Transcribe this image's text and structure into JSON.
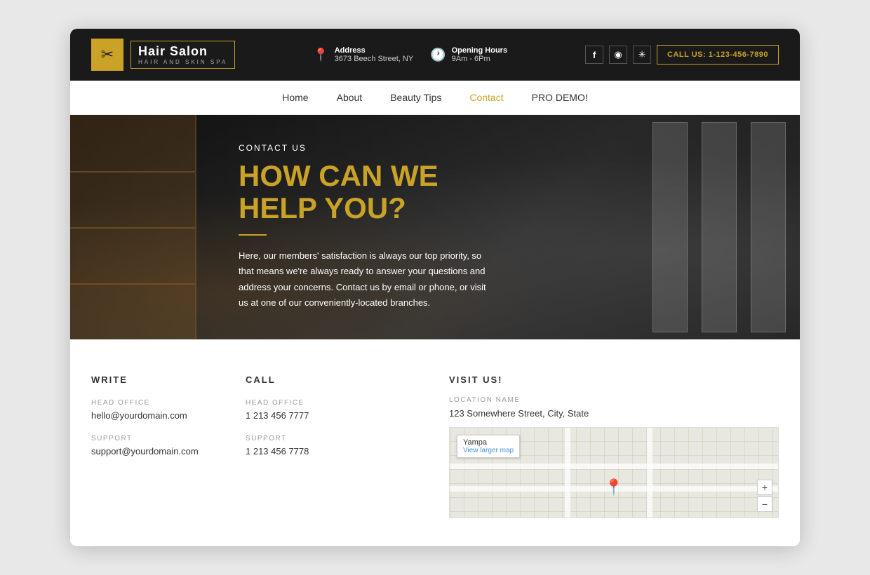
{
  "header": {
    "logo": {
      "icon": "✂",
      "name": "Hair Salon",
      "subtitle": "HAIR AND SKIN SPA"
    },
    "address_label": "Address",
    "address_value": "3673 Beech Street, NY",
    "hours_label": "Opening Hours",
    "hours_value": "9Am - 6Pm",
    "call_button": "CALL US: 1-123-456-7890"
  },
  "nav": {
    "items": [
      {
        "label": "Home",
        "active": false
      },
      {
        "label": "About",
        "active": false
      },
      {
        "label": "Beauty Tips",
        "active": false
      },
      {
        "label": "Contact",
        "active": true
      },
      {
        "label": "PRO DEMO!",
        "active": false
      }
    ]
  },
  "hero": {
    "contact_label": "CONTACT US",
    "title": "HOW CAN WE HELP YOU?",
    "description": "Here, our members' satisfaction is always our top priority, so that means we're always ready to answer your questions and address your concerns. Contact us by email or phone, or visit us at one of our conveniently-located branches."
  },
  "contact": {
    "write_title": "WRITE",
    "call_title": "CALL",
    "write_entries": [
      {
        "label": "HEAD OFFICE",
        "value": "hello@yourdomain.com"
      },
      {
        "label": "SUPPORT",
        "value": "support@yourdomain.com"
      }
    ],
    "call_entries": [
      {
        "label": "HEAD OFFICE",
        "value": "1 213 456 7777"
      },
      {
        "label": "SUPPORT",
        "value": "1 213 456 7778"
      }
    ],
    "visit_title": "VISIT US!",
    "location_label": "LOCATION NAME",
    "location_value": "123 Somewhere Street, City, State",
    "map": {
      "label": "Yampa",
      "link": "View larger map",
      "plus": "+",
      "minus": "−"
    }
  },
  "social": {
    "facebook": "f",
    "instagram": "◉",
    "yelp": "✳"
  }
}
